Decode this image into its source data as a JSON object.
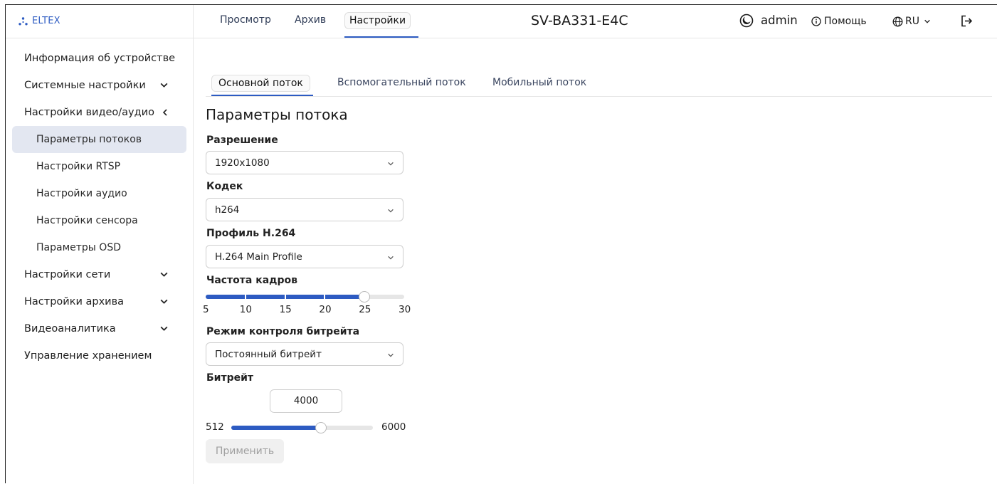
{
  "brand": {
    "name": "ELTEX",
    "color": "#2d5bc2"
  },
  "header": {
    "tabs": [
      {
        "label": "Просмотр",
        "active": false
      },
      {
        "label": "Архив",
        "active": false
      },
      {
        "label": "Настройки",
        "active": true
      }
    ],
    "device_name": "SV-BA331-E4C",
    "theme_icon": "moon-icon",
    "user": "admin",
    "help_label": "Помощь",
    "help_icon": "info-icon",
    "language": "RU",
    "language_icon": "globe-icon",
    "logout_icon": "logout-icon"
  },
  "sidebar": {
    "items": [
      {
        "label": "Информация об устройстве",
        "chevron": "none"
      },
      {
        "label": "Системные настройки",
        "chevron": "down"
      },
      {
        "label": "Настройки видео/аудио",
        "chevron": "left",
        "expanded": true
      },
      {
        "label": "Параметры потоков",
        "sub": true,
        "active": true
      },
      {
        "label": "Настройки RTSP",
        "sub": true
      },
      {
        "label": "Настройки аудио",
        "sub": true
      },
      {
        "label": "Настройки сенсора",
        "sub": true
      },
      {
        "label": "Параметры OSD",
        "sub": true
      },
      {
        "label": "Настройки сети",
        "chevron": "down"
      },
      {
        "label": "Настройки архива",
        "chevron": "down"
      },
      {
        "label": "Видеоаналитика",
        "chevron": "down"
      },
      {
        "label": "Управление хранением",
        "chevron": "none"
      }
    ]
  },
  "content": {
    "stream_tabs": [
      {
        "label": "Основной поток",
        "active": true
      },
      {
        "label": "Вспомогательный поток",
        "active": false
      },
      {
        "label": "Мобильный поток",
        "active": false
      }
    ],
    "section_title": "Параметры потока",
    "resolution": {
      "label": "Разрешение",
      "value": "1920x1080"
    },
    "codec": {
      "label": "Кодек",
      "value": "h264"
    },
    "profile": {
      "label": "Профиль H.264",
      "value": "H.264 Main Profile"
    },
    "framerate": {
      "label": "Частота кадров",
      "ticks": [
        "5",
        "10",
        "15",
        "20",
        "25",
        "30"
      ],
      "min": 5,
      "max": 30,
      "value": 25
    },
    "bitrate_mode": {
      "label": "Режим контроля битрейта",
      "value": "Постоянный битрейт"
    },
    "bitrate": {
      "label": "Битрейт",
      "value": "4000",
      "min_label": "512",
      "max_label": "6000",
      "min": 512,
      "max": 6000,
      "numeric": 4000
    },
    "apply_label": "Применить"
  },
  "colors": {
    "accent": "#2d5bc2",
    "active_nav_bg": "#e3e7f1",
    "disabled_button_bg": "#f0f0f0",
    "disabled_button_text": "#a0a0a0"
  }
}
